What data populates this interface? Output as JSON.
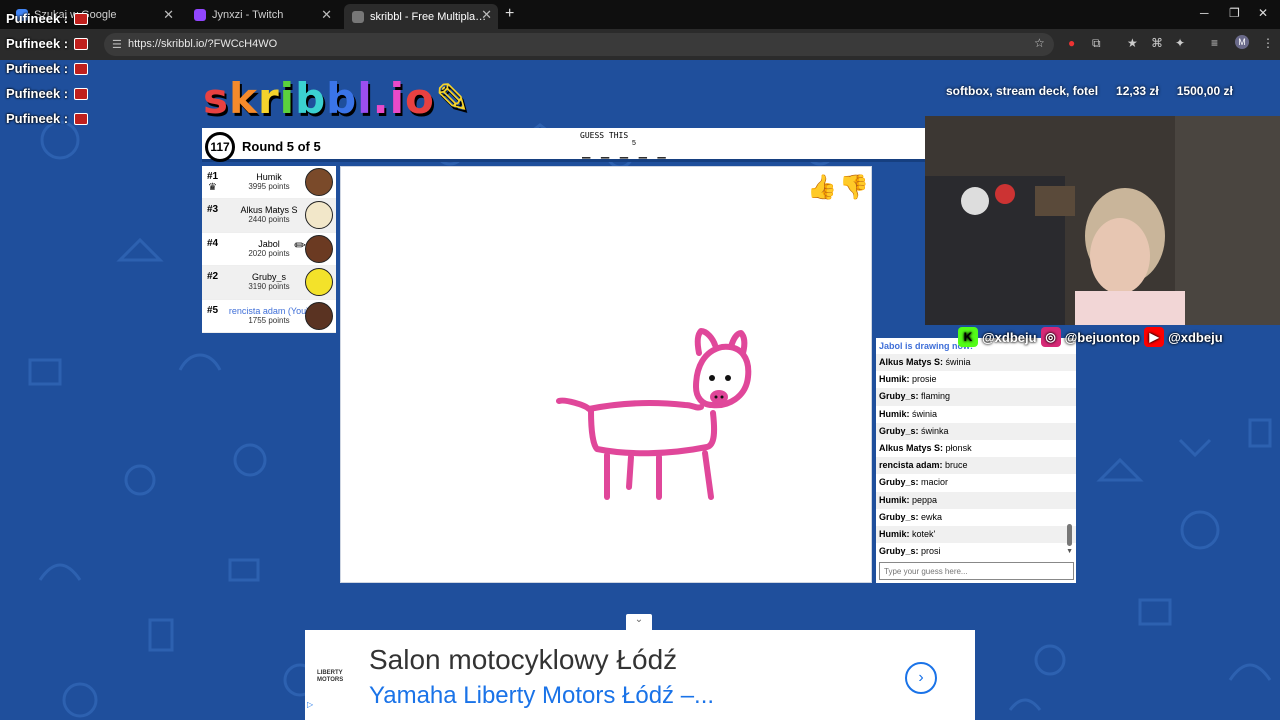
{
  "browser": {
    "tabs": [
      {
        "title": "Szukaj w Google",
        "icon_color": "#4285f4",
        "active": false
      },
      {
        "title": "Jynxzi - Twitch",
        "icon_color": "#9146ff",
        "active": false
      },
      {
        "title": "skribbl - Free Multiplayer Drawing",
        "icon_color": "#555555",
        "active": true
      }
    ],
    "url": "https://skribbl.io/?FWCcH4WO"
  },
  "overlay_chat": {
    "lines": [
      "Pufineek :",
      "Pufineek :",
      "Pufineek :",
      "Pufineek :",
      "Pufineek :"
    ]
  },
  "game": {
    "logo": "skribbl.io",
    "timer": "117",
    "round": "Round 5 of 5",
    "guess_label": "GUESS THIS",
    "word_blanks": "_ _ _ _ _",
    "word_length": "5",
    "players": [
      {
        "rank": "#1",
        "name": "Humik",
        "points": "3995 points",
        "avatar_color": "#7a4a2a",
        "crown": true,
        "drawing": false,
        "you": false
      },
      {
        "rank": "#3",
        "name": "Alkus Matys S",
        "points": "2440 points",
        "avatar_color": "#f2e7c9",
        "crown": false,
        "drawing": false,
        "you": false
      },
      {
        "rank": "#4",
        "name": "Jabol",
        "points": "2020 points",
        "avatar_color": "#6b3a22",
        "crown": false,
        "drawing": true,
        "you": false
      },
      {
        "rank": "#2",
        "name": "Gruby_s",
        "points": "3190 points",
        "avatar_color": "#f3e22a",
        "crown": false,
        "drawing": false,
        "you": false
      },
      {
        "rank": "#5",
        "name": "rencista adam (You)",
        "points": "1755 points",
        "avatar_color": "#5a3322",
        "crown": false,
        "drawing": false,
        "you": true
      }
    ],
    "drawing_color": "#e0479a"
  },
  "chat": {
    "header": "Jabol is drawing now!",
    "messages": [
      {
        "user": "Alkus Matys S:",
        "text": "świnia"
      },
      {
        "user": "Humik:",
        "text": "prosie"
      },
      {
        "user": "Gruby_s:",
        "text": "flaming"
      },
      {
        "user": "Humik:",
        "text": "świnia"
      },
      {
        "user": "Gruby_s:",
        "text": "świnka"
      },
      {
        "user": "Alkus Matys S:",
        "text": "płonsk"
      },
      {
        "user": "rencista adam:",
        "text": "bruce"
      },
      {
        "user": "Gruby_s:",
        "text": "macior"
      },
      {
        "user": "Humik:",
        "text": "peppa"
      },
      {
        "user": "Gruby_s:",
        "text": "ewka"
      },
      {
        "user": "Humik:",
        "text": "kotek'"
      },
      {
        "user": "Gruby_s:",
        "text": "prosi"
      }
    ],
    "input_placeholder": "Type your guess here..."
  },
  "stream": {
    "goal_text": "softbox, stream deck, fotel",
    "goal_current": "12,33 zł",
    "goal_target": "1500,00 zł",
    "socials": [
      {
        "handle": "@xdbeju",
        "icon": "kick-icon",
        "color": "#53fc18"
      },
      {
        "handle": "@bejuontop",
        "icon": "instagram-icon",
        "color": "#d62976"
      },
      {
        "handle": "@xdbeju",
        "icon": "youtube-icon",
        "color": "#ff0000"
      }
    ]
  },
  "ad": {
    "advertiser": "LIBERTY MOTORS",
    "title": "Salon motocyklowy Łódź",
    "subtitle": "Yamaha Liberty Motors Łódź –..."
  }
}
